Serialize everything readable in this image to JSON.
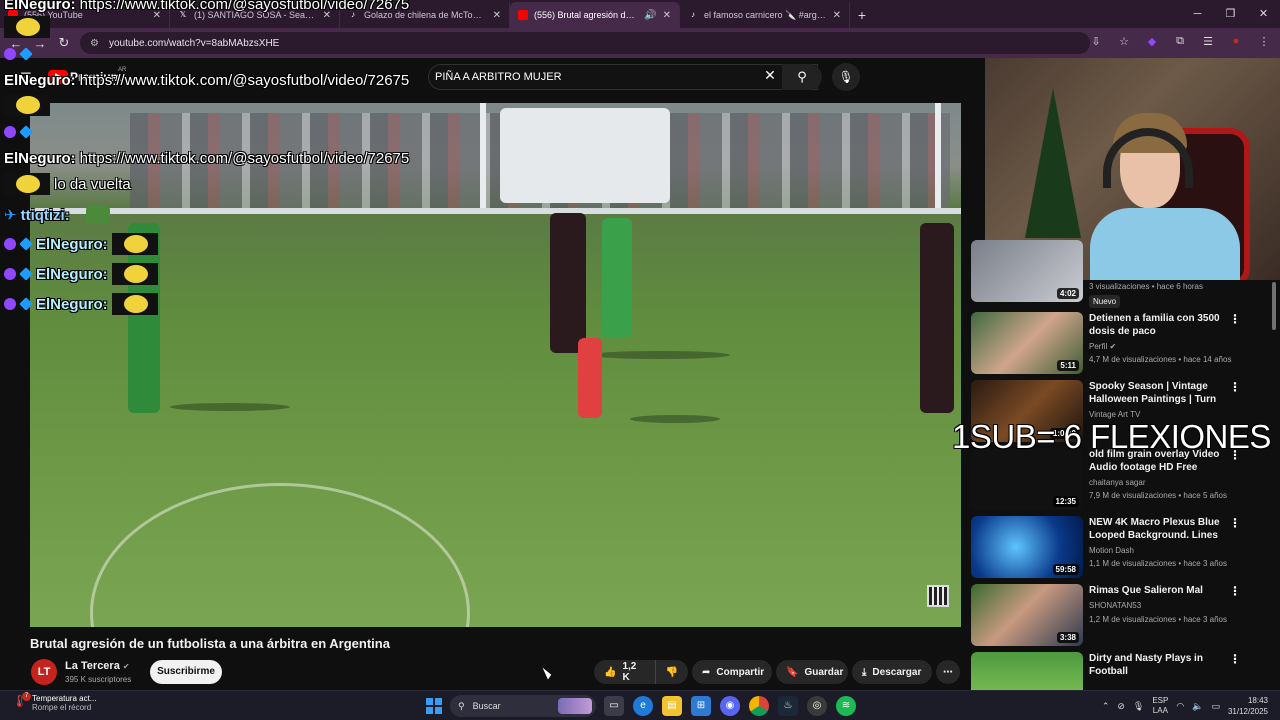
{
  "browser": {
    "tabs": [
      {
        "title": "(556) YouTube",
        "favicon": "youtube-icon",
        "color": "#ff0000"
      },
      {
        "title": "(1) SANTIAGO SOSA - Search /",
        "favicon": "x-icon",
        "color": "#ffffff"
      },
      {
        "title": "Golazo de chilena de McTomin",
        "favicon": "tiktok-icon",
        "color": "#ffffff"
      },
      {
        "title": "(556) Brutal agresión de un",
        "favicon": "youtube-icon",
        "color": "#ff0000",
        "active": true
      },
      {
        "title": "el famoso carnicero 🔪 #argen",
        "favicon": "tiktok-icon",
        "color": "#ffffff"
      }
    ],
    "url": "youtube.com/watch?v=8abMAbzsXHE"
  },
  "youtube": {
    "logo_text": "Premium",
    "country": "AR",
    "search_value": "PIÑA A ARBITRO MUJER",
    "video_title": "Brutal agresión de un futbolista a una árbitra en Argentina",
    "channel": {
      "initials": "LT",
      "name": "La Tercera",
      "subs": "395 K suscriptores"
    },
    "subscribe_label": "Suscribirme",
    "like_count": "1,2 K",
    "share_label": "Compartir",
    "save_label": "Guardar",
    "download_label": "Descargar"
  },
  "chat": [
    {
      "user": "ElNeguro:",
      "msg": "https://www.tiktok.com/@sayosfutbol/video/72675"
    },
    {
      "user": "ElNeguro:",
      "msg": "https://www.tiktok.com/@sayosfutbol/video/72675"
    },
    {
      "user": "ElNeguro:",
      "msg": "https://www.tiktok.com/@sayosfutbol/video/72675"
    },
    {
      "user": "",
      "msg": "lo da vuelta"
    },
    {
      "user": "ttiqtizi:",
      "msg": ""
    },
    {
      "user": "ElNeguro:",
      "msg": ""
    },
    {
      "user": "ElNeguro:",
      "msg": ""
    },
    {
      "user": "ElNeguro:",
      "msg": ""
    }
  ],
  "overlay_text": "1SUB= 6 FLEXIONES",
  "recommendations": [
    {
      "title": "",
      "channel": "",
      "meta": "3 visualizaciones • hace 6 horas",
      "badge": "Nuevo",
      "duration": "4:02"
    },
    {
      "title": "Detienen a familia con 3500 dosis de paco",
      "channel": "Perfil ✔",
      "meta": "4,7 M de visualizaciones • hace 14 años",
      "duration": "5:11"
    },
    {
      "title": "Spooky Season | Vintage Halloween Paintings | Turn Yo...",
      "channel": "Vintage Art TV",
      "meta": "",
      "duration": "1:00:0"
    },
    {
      "title": "old film grain overlay  Video Audio footage HD Free",
      "channel": "chaitanya sagar",
      "meta": "7,9 M de visualizaciones • hace 5 años",
      "duration": "12:35"
    },
    {
      "title": "NEW 4K Macro Plexus Blue Looped Background. Lines an...",
      "channel": "Motion Dash",
      "meta": "1,1 M de visualizaciones • hace 3 años",
      "duration": "59:58"
    },
    {
      "title": "Rimas Que Salieron Mal",
      "channel": "SHONATAN53",
      "meta": "1,2 M de visualizaciones • hace 3 años",
      "duration": "3:38"
    },
    {
      "title": "Dirty and Nasty Plays in Football",
      "channel": "",
      "meta": "",
      "duration": ""
    }
  ],
  "taskbar": {
    "weather_title": "Temperatura act...",
    "weather_sub": "Rompe el récord",
    "weather_badge": "7",
    "search_placeholder": "Buscar",
    "lang_line1": "ESP",
    "lang_line2": "LAA",
    "time": "18:43",
    "date": "31/12/2025"
  }
}
